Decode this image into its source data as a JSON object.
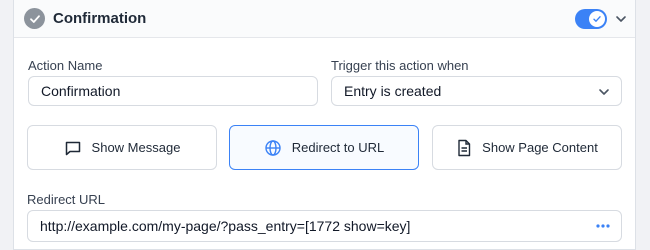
{
  "header": {
    "title": "Confirmation",
    "enabled": true
  },
  "action_name": {
    "label": "Action Name",
    "value": "Confirmation"
  },
  "trigger": {
    "label": "Trigger this action when",
    "selected": "Entry is created"
  },
  "options": [
    {
      "label": "Show Message",
      "icon": "message-icon",
      "active": false
    },
    {
      "label": "Redirect to URL",
      "icon": "globe-icon",
      "active": true
    },
    {
      "label": "Show Page Content",
      "icon": "document-icon",
      "active": false
    }
  ],
  "redirect": {
    "label": "Redirect URL",
    "value": "http://example.com/my-page/?pass_entry=[1772 show=key]"
  },
  "colors": {
    "accent": "#3b82f6",
    "border": "#d7dbe1",
    "background": "#f1f2f5"
  }
}
